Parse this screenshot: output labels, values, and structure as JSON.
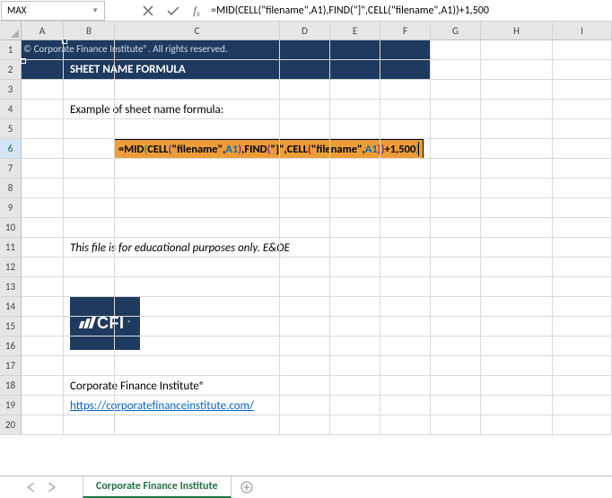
{
  "namebox": {
    "value": "MAX"
  },
  "formula_bar": {
    "value": "=MID(CELL(\"filename\",A1),FIND(\"]\",CELL(\"filename\",A1))+1,500"
  },
  "columns": [
    "A",
    "B",
    "C",
    "D",
    "E",
    "F",
    "G",
    "H",
    "I"
  ],
  "rows": [
    "1",
    "2",
    "3",
    "4",
    "5",
    "6",
    "7",
    "8",
    "9",
    "10",
    "11",
    "12",
    "13",
    "14",
    "15",
    "16",
    "17",
    "18",
    "19",
    "20"
  ],
  "selected_row": "6",
  "header": {
    "row1": "© Corporate Finance Institute®. All rights reserved.",
    "row2": "SHEET NAME FORMULA"
  },
  "content": {
    "example_label": "Example of sheet name formula:",
    "disclaimer": "This file is for educational purposes only. E&OE",
    "company": "Corporate Finance Institute®",
    "url": "https://corporatefinanceinstitute.com/",
    "logo_text": "CFI"
  },
  "formula_tokens": [
    {
      "t": "=MID",
      "c": "blk"
    },
    {
      "t": "(",
      "c": "green"
    },
    {
      "t": "CELL",
      "c": "blk"
    },
    {
      "t": "(",
      "c": "purple"
    },
    {
      "t": "\"filename\",",
      "c": "blk"
    },
    {
      "t": "A1",
      "c": "blue"
    },
    {
      "t": ")",
      "c": "purple"
    },
    {
      "t": ",",
      "c": "blk"
    },
    {
      "t": "FIND",
      "c": "blk"
    },
    {
      "t": "(",
      "c": "purple"
    },
    {
      "t": "\"]\",",
      "c": "blk"
    },
    {
      "t": "CELL",
      "c": "blk"
    },
    {
      "t": "(",
      "c": "red"
    },
    {
      "t": "\"filename\",",
      "c": "blk"
    },
    {
      "t": "A1",
      "c": "blue"
    },
    {
      "t": ")",
      "c": "red"
    },
    {
      "t": ")",
      "c": "purple"
    },
    {
      "t": "+1,500",
      "c": "blk"
    },
    {
      "t": ")",
      "c": "green"
    }
  ],
  "tab": {
    "active": "Corporate Finance Institute"
  }
}
